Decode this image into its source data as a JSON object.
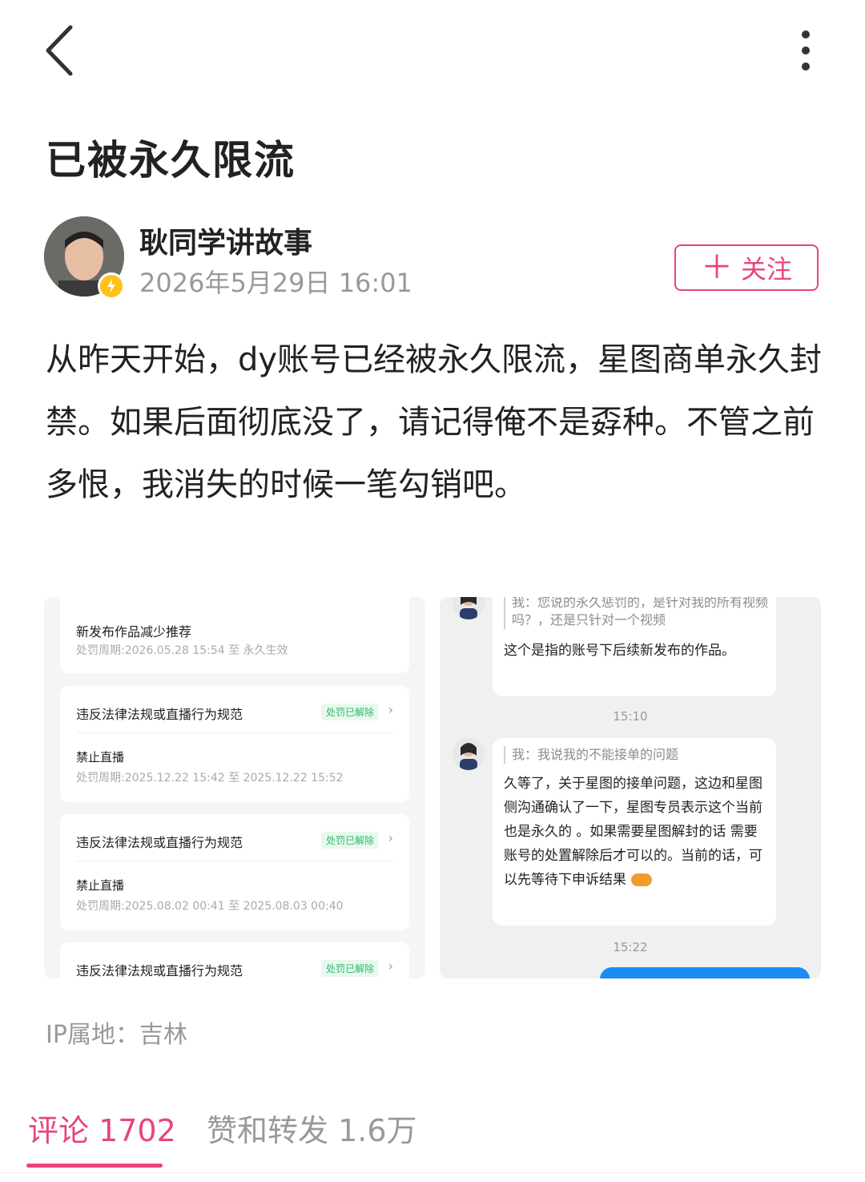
{
  "header": {
    "back_icon": "chevron-left-icon",
    "more_icon": "more-vertical-icon"
  },
  "post": {
    "title": "已被永久限流",
    "author": "耿同学讲故事",
    "timestamp": "2026年5月29日 16:01",
    "follow_label": "关注",
    "content": "从昨天开始，dy账号已经被永久限流，星图商单永久封禁。如果后面彻底没了，请记得俺不是孬种。不管之前多恨，我消失的时候一笔勾销吧。",
    "ip_location": "IP属地：吉林"
  },
  "screenshot_left": {
    "cards": [
      {
        "title": "新发布作品减少推荐",
        "period": "处罚周期:2026.05.28 15:54 至 永久生效"
      },
      {
        "title": "违反法律法规或直播行为规范",
        "status": "处罚已解除",
        "detail": "禁止直播",
        "period": "处罚周期:2025.12.22 15:42 至 2025.12.22 15:52"
      },
      {
        "title": "违反法律法规或直播行为规范",
        "status": "处罚已解除",
        "detail": "禁止直播",
        "period": "处罚周期:2025.08.02 00:41 至 2025.08.03 00:40"
      },
      {
        "title": "违反法律法规或直播行为规范",
        "status": "处罚已解除"
      }
    ]
  },
  "screenshot_right": {
    "msg1_quote": "我：您说的永久惩罚的，是针对我的所有视频吗？，还是只针对一个视频",
    "msg1_reply": "这个是指的账号下后续新发布的作品。",
    "time1": "15:10",
    "msg2_quote": "我：我说我的不能接单的问题",
    "msg2_reply": "久等了，关于星图的接单问题，这边和星图侧沟通确认了一下，星图专员表示这个当前也是永久的 。如果需要星图解封的话 需要账号的处置解除后才可以的。当前的话，可以先等待下申诉结果",
    "time2": "15:22"
  },
  "tabs": {
    "comments": "评论 1702",
    "likes_reposts": "赞和转发 1.6万"
  },
  "colors": {
    "accent": "#e9457a",
    "muted": "#999999",
    "status_green": "#2dbb6b"
  }
}
